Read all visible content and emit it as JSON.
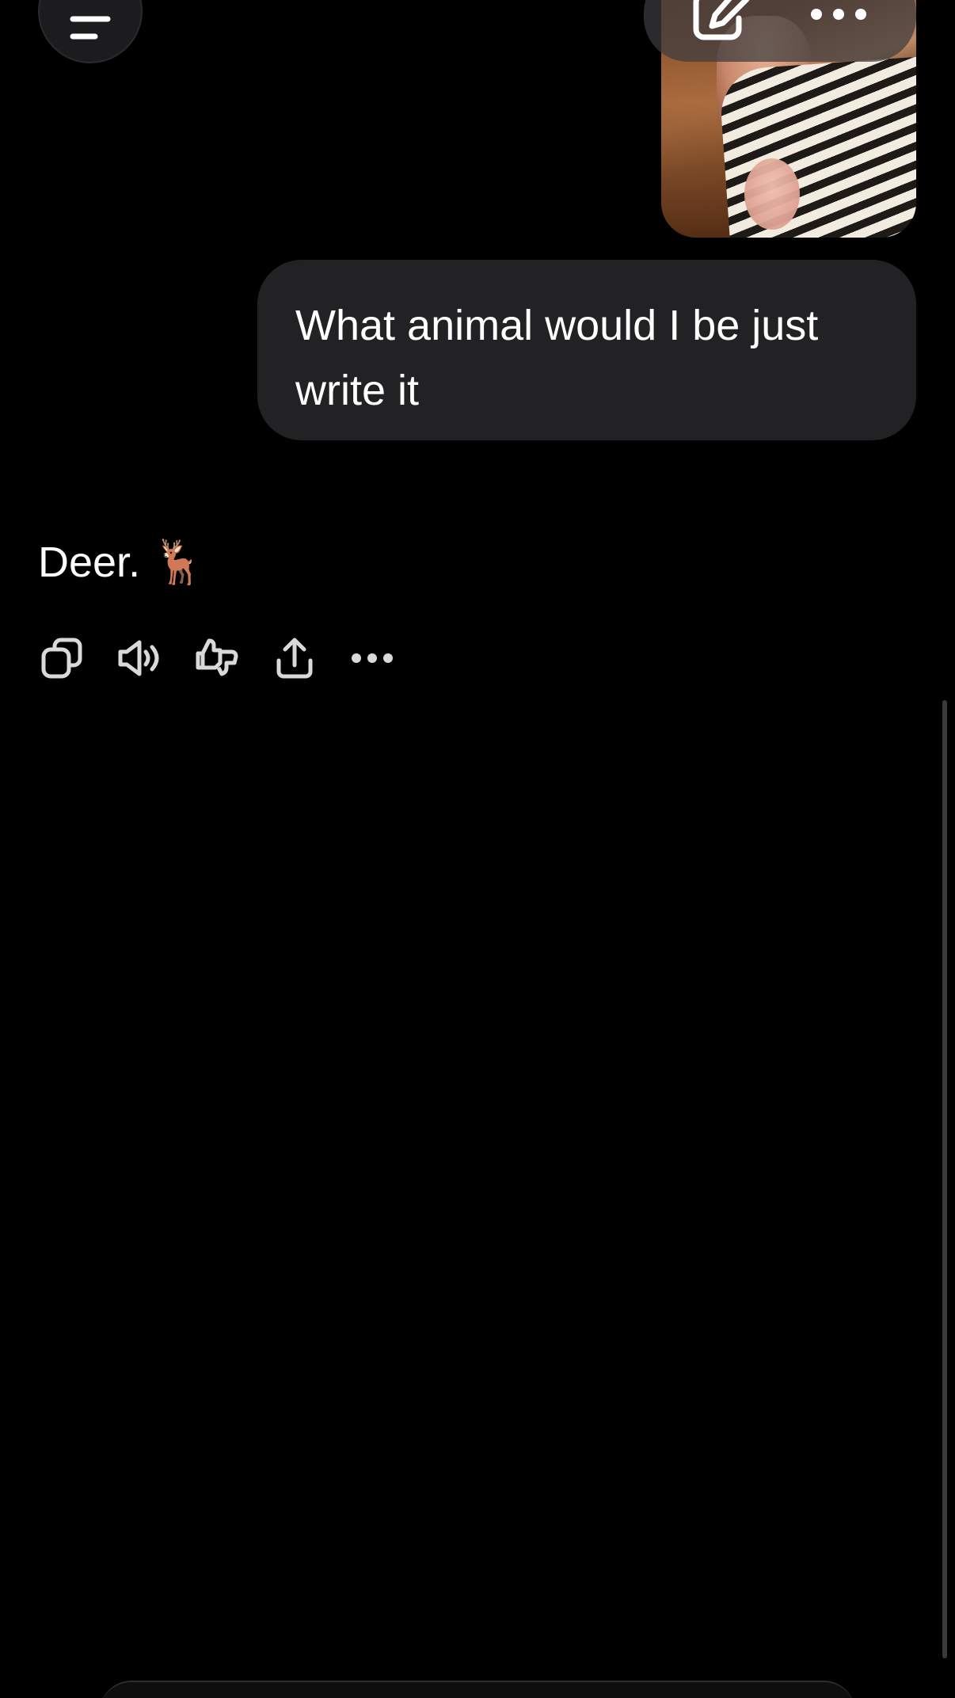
{
  "header": {
    "menu_icon": "menu-icon",
    "edit_icon": "compose-icon",
    "more_icon": "more-horizontal-icon"
  },
  "conversation": {
    "attachment": {
      "type": "image",
      "description_icon": "photo-thumbnail"
    },
    "user_message": "What animal would I be just write it",
    "assistant_message": "Deer. 🦌",
    "actions": [
      {
        "name": "copy",
        "icon": "copy-icon"
      },
      {
        "name": "read-aloud",
        "icon": "speaker-icon"
      },
      {
        "name": "feedback",
        "icon": "thumbs-up-down-icon"
      },
      {
        "name": "share",
        "icon": "share-icon"
      },
      {
        "name": "more",
        "icon": "more-horizontal-icon"
      }
    ]
  },
  "colors": {
    "background": "#000000",
    "bubble": "#222224",
    "text": "#ffffff",
    "icon": "#d9d9d9"
  }
}
